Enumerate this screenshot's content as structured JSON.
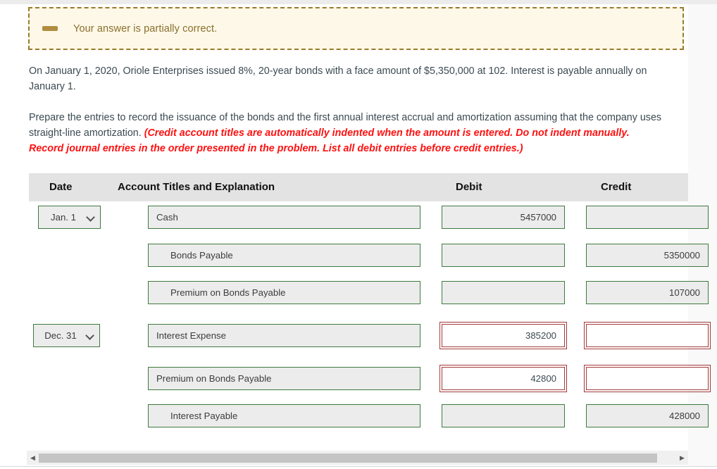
{
  "alert": {
    "icon": "minus-icon",
    "message": "Your answer is partially correct.",
    "bg_color": "#fdf8e7",
    "border_color": "#9a7b2b",
    "text_color": "#8a6f2e"
  },
  "problem": {
    "paragraph1": "On January 1, 2020, Oriole Enterprises issued 8%, 20-year bonds with a face amount of $5,350,000 at 102. Interest is payable annually on January 1.",
    "paragraph2_plain": "Prepare the entries to record the issuance of the bonds and the first annual interest accrual and amortization assuming that the company uses straight-line amortization. ",
    "paragraph2_emphasis": "(Credit account titles are automatically indented when the amount is entered. Do not indent manually. Record journal entries in the order presented in the problem. List all debit entries before credit entries.)",
    "emphasis_color": "#ff1111"
  },
  "table": {
    "headers": {
      "date": "Date",
      "account": "Account Titles and Explanation",
      "debit": "Debit",
      "credit": "Credit"
    },
    "rows": [
      {
        "date": "Jan. 1",
        "has_date": true,
        "account": "Cash",
        "indent": false,
        "debit": "5457000",
        "credit": "",
        "debit_error": false,
        "credit_error": false
      },
      {
        "date": "",
        "has_date": false,
        "account": "Bonds Payable",
        "indent": true,
        "debit": "",
        "credit": "5350000",
        "debit_error": false,
        "credit_error": false
      },
      {
        "date": "",
        "has_date": false,
        "account": "Premium on Bonds Payable",
        "indent": true,
        "debit": "",
        "credit": "107000",
        "debit_error": false,
        "credit_error": false
      },
      {
        "date": "Dec. 31",
        "has_date": true,
        "account": "Interest Expense",
        "indent": false,
        "debit": "385200",
        "credit": "",
        "debit_error": true,
        "credit_error": true
      },
      {
        "date": "",
        "has_date": false,
        "account": "Premium on Bonds Payable",
        "indent": false,
        "debit": "42800",
        "credit": "",
        "debit_error": true,
        "credit_error": true
      },
      {
        "date": "",
        "has_date": false,
        "account": "Interest Payable",
        "indent": true,
        "debit": "",
        "credit": "428000",
        "debit_error": false,
        "credit_error": false
      }
    ],
    "header_bg": "#e3e3e3",
    "field_bg": "#ececec",
    "field_border": "#3f7a3f",
    "error_border": "#a33a3a"
  },
  "scrollbar": {
    "left_arrow": "◀",
    "right_arrow": "▶"
  }
}
